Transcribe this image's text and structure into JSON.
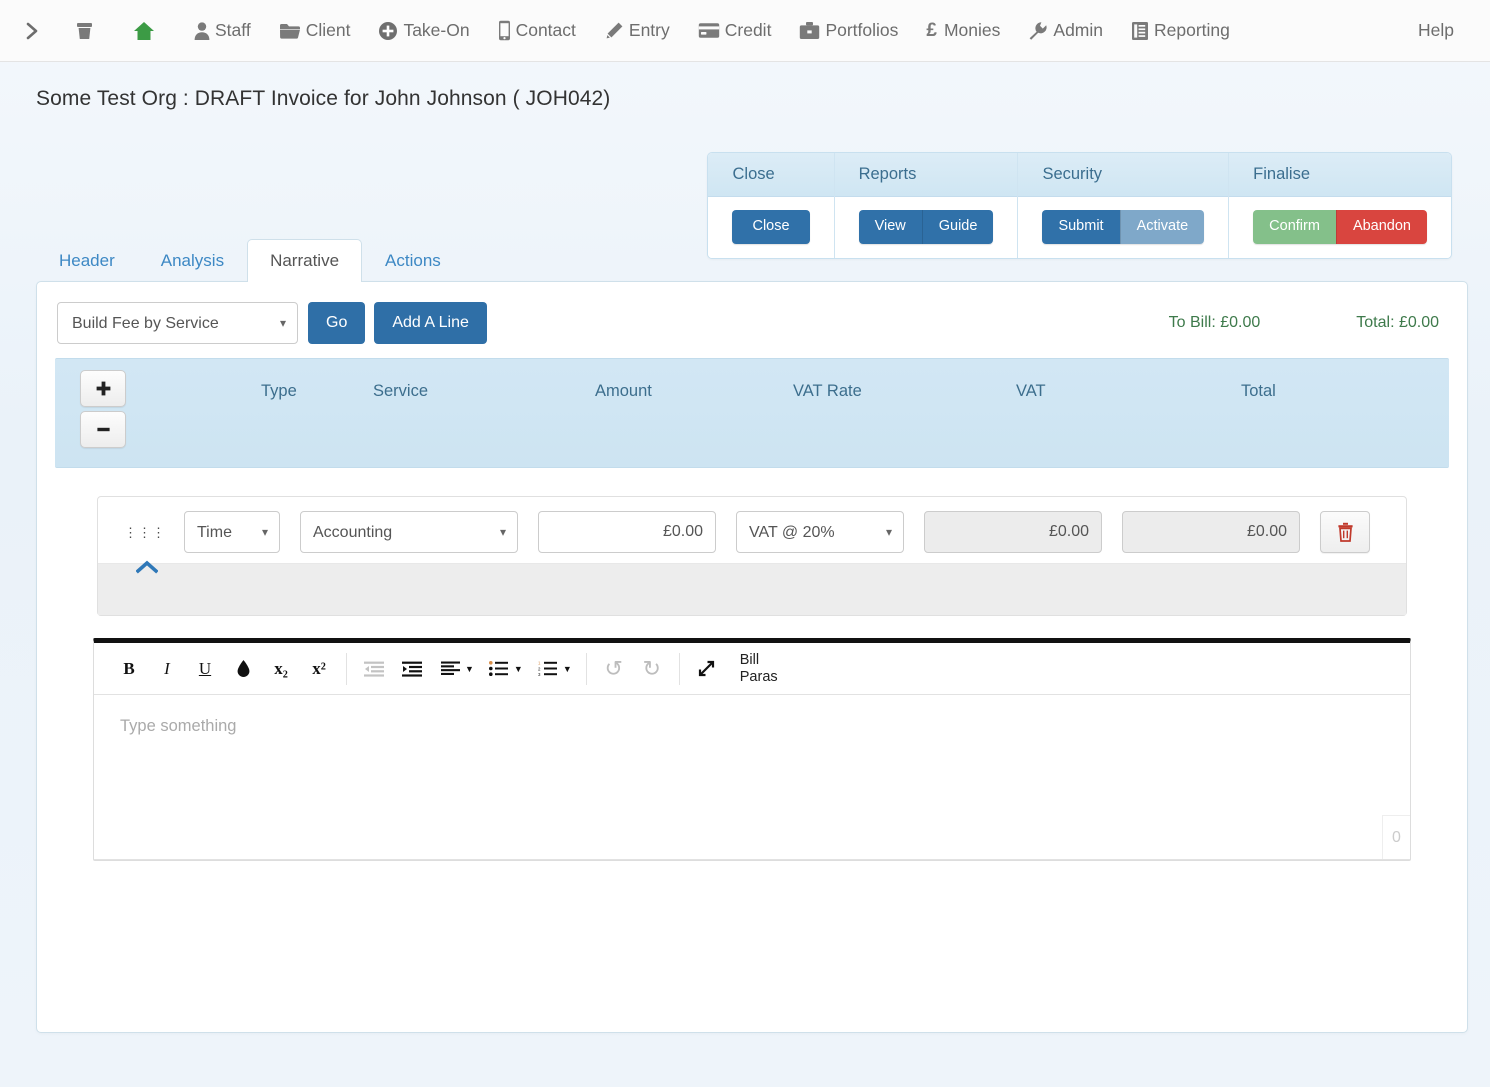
{
  "nav": {
    "items": [
      {
        "label": "",
        "icon": "chevron-right-icon",
        "name": "nav-expand"
      },
      {
        "label": "",
        "icon": "archive-icon",
        "name": "nav-archive"
      },
      {
        "label": "",
        "icon": "home-icon",
        "name": "nav-home"
      },
      {
        "label": "Staff",
        "icon": "user-icon",
        "name": "nav-staff"
      },
      {
        "label": "Client",
        "icon": "folder-icon",
        "name": "nav-client"
      },
      {
        "label": "Take-On",
        "icon": "plus-circle-icon",
        "name": "nav-takeon"
      },
      {
        "label": "Contact",
        "icon": "mobile-icon",
        "name": "nav-contact"
      },
      {
        "label": "Entry",
        "icon": "pencil-icon",
        "name": "nav-entry"
      },
      {
        "label": "Credit",
        "icon": "credit-card-icon",
        "name": "nav-credit"
      },
      {
        "label": "Portfolios",
        "icon": "briefcase-icon",
        "name": "nav-portfolios"
      },
      {
        "label": "Monies",
        "icon": "pound-icon",
        "name": "nav-monies"
      },
      {
        "label": "Admin",
        "icon": "wrench-icon",
        "name": "nav-admin"
      },
      {
        "label": "Reporting",
        "icon": "report-icon",
        "name": "nav-reporting"
      }
    ],
    "help": "Help"
  },
  "header": {
    "title": "Some Test Org : DRAFT Invoice for John Johnson ( JOH042)"
  },
  "actions": {
    "groups": [
      {
        "title": "Close",
        "buttons": [
          {
            "label": "Close",
            "style": "blue"
          }
        ]
      },
      {
        "title": "Reports",
        "buttons": [
          {
            "label": "View",
            "style": "blue"
          },
          {
            "label": "Guide",
            "style": "blue"
          }
        ]
      },
      {
        "title": "Security",
        "buttons": [
          {
            "label": "Submit",
            "style": "blue"
          },
          {
            "label": "Activate",
            "style": "blue-light"
          }
        ]
      },
      {
        "title": "Finalise",
        "buttons": [
          {
            "label": "Confirm",
            "style": "green"
          },
          {
            "label": "Abandon",
            "style": "red"
          }
        ]
      }
    ]
  },
  "tabs": [
    {
      "label": "Header",
      "active": false
    },
    {
      "label": "Analysis",
      "active": false
    },
    {
      "label": "Narrative",
      "active": true
    },
    {
      "label": "Actions",
      "active": false
    }
  ],
  "toolbar": {
    "build_select_value": "Build Fee by Service",
    "build_select_options": [
      "Build Fee by Service"
    ],
    "go_label": "Go",
    "add_line_label": "Add A Line",
    "to_bill": "To Bill: £0.00",
    "total": "Total: £0.00"
  },
  "table": {
    "add_row_label": "+",
    "remove_row_label": "–",
    "columns": [
      "Type",
      "Service",
      "Amount",
      "VAT Rate",
      "VAT",
      "Total"
    ]
  },
  "line": {
    "type_value": "Time",
    "type_options": [
      "Time"
    ],
    "service_value": "Accounting",
    "service_options": [
      "Accounting"
    ],
    "amount_value": "£0.00",
    "vat_rate_value": "VAT @ 20%",
    "vat_rate_options": [
      "VAT @ 20%"
    ],
    "vat_value": "£0.00",
    "total_value": "£0.00",
    "delete_icon": "trash-icon"
  },
  "editor": {
    "buttons": [
      {
        "name": "bold-icon",
        "glyph": "B",
        "disabled": false
      },
      {
        "name": "italic-icon",
        "glyph": "I",
        "disabled": false
      },
      {
        "name": "underline-icon",
        "glyph": "U",
        "disabled": false
      },
      {
        "name": "text-color-icon",
        "glyph": "◆",
        "disabled": false
      },
      {
        "name": "subscript-icon",
        "glyph": "x₂",
        "disabled": false
      },
      {
        "name": "superscript-icon",
        "glyph": "x²",
        "disabled": false
      },
      {
        "name": "outdent-icon",
        "glyph": "",
        "disabled": true
      },
      {
        "name": "indent-icon",
        "glyph": "",
        "disabled": false
      },
      {
        "name": "align-icon",
        "glyph": "",
        "disabled": false
      },
      {
        "name": "unordered-list-icon",
        "glyph": "",
        "disabled": false
      },
      {
        "name": "ordered-list-icon",
        "glyph": "",
        "disabled": false
      },
      {
        "name": "undo-icon",
        "glyph": "↺",
        "disabled": true
      },
      {
        "name": "redo-icon",
        "glyph": "↻",
        "disabled": true
      },
      {
        "name": "fullscreen-icon",
        "glyph": "⤡",
        "disabled": false
      }
    ],
    "bill_paras_line1": "Bill",
    "bill_paras_line2": "Paras",
    "placeholder": "Type something",
    "char_count": "0"
  },
  "colors": {
    "accent_blue": "#2f6fa7",
    "band_blue": "#cfe4f2",
    "green": "#3e7a4b",
    "red": "#d9453f",
    "confirm_green": "#84c08a"
  }
}
